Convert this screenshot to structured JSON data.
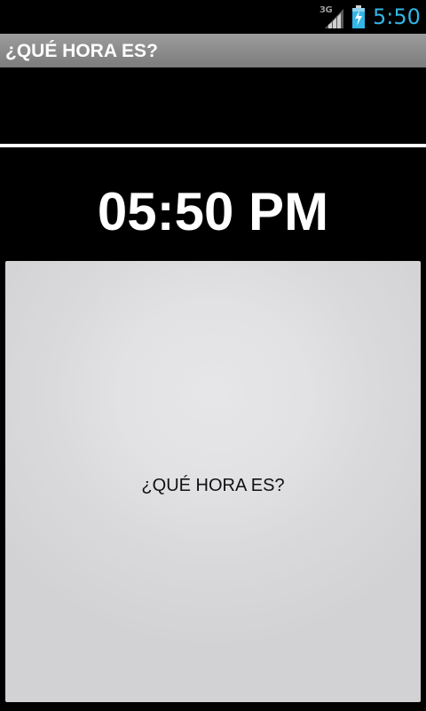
{
  "status_bar": {
    "network": "3G",
    "time": "5:50",
    "battery_icon": "battery-charging-icon",
    "signal_icon": "signal-icon",
    "accent_color": "#33b5e5"
  },
  "app": {
    "title": "¿QUÉ HORA ES?"
  },
  "main": {
    "time": "05:50 PM",
    "button_label": "¿QUÉ HORA ES?"
  }
}
